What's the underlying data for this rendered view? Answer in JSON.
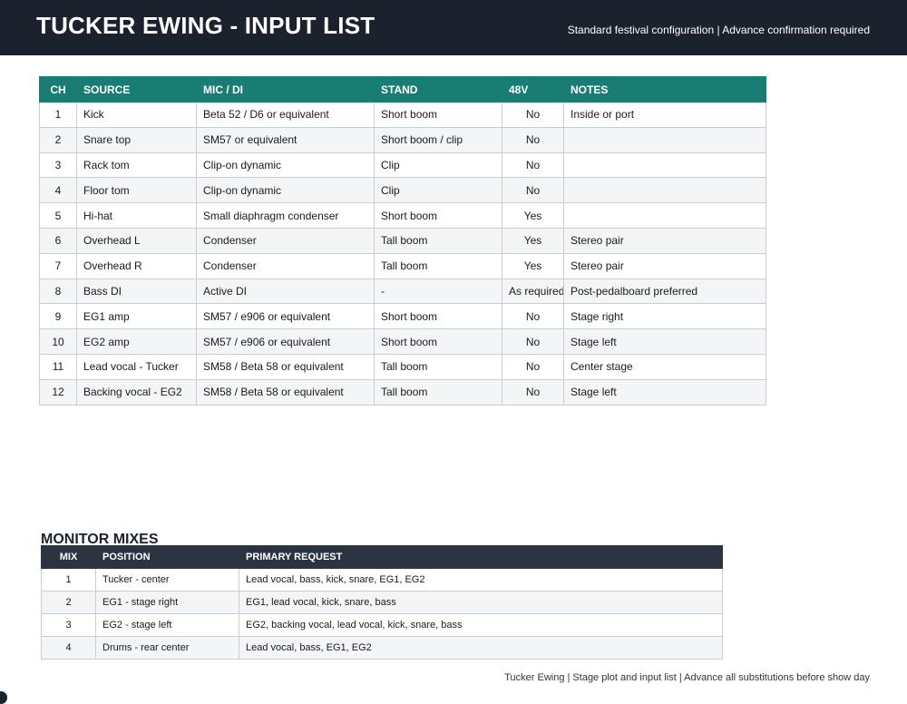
{
  "header": {
    "title": "TUCKER EWING - INPUT LIST",
    "subtitle": "Standard festival configuration | Advance confirmation required"
  },
  "input_list": {
    "columns": [
      "CH",
      "SOURCE",
      "MIC / DI",
      "STAND",
      "48V",
      "NOTES"
    ],
    "rows": [
      {
        "ch": "1",
        "source": "Kick",
        "mic": "Beta 52 / D6 or equivalent",
        "stand": "Short boom",
        "phantom": "No",
        "notes": "Inside or port"
      },
      {
        "ch": "2",
        "source": "Snare top",
        "mic": "SM57 or equivalent",
        "stand": "Short boom / clip",
        "phantom": "No",
        "notes": ""
      },
      {
        "ch": "3",
        "source": "Rack tom",
        "mic": "Clip-on dynamic",
        "stand": "Clip",
        "phantom": "No",
        "notes": ""
      },
      {
        "ch": "4",
        "source": "Floor tom",
        "mic": "Clip-on dynamic",
        "stand": "Clip",
        "phantom": "No",
        "notes": ""
      },
      {
        "ch": "5",
        "source": "Hi-hat",
        "mic": "Small diaphragm condenser",
        "stand": "Short boom",
        "phantom": "Yes",
        "notes": ""
      },
      {
        "ch": "6",
        "source": "Overhead L",
        "mic": "Condenser",
        "stand": "Tall boom",
        "phantom": "Yes",
        "notes": "Stereo pair"
      },
      {
        "ch": "7",
        "source": "Overhead R",
        "mic": "Condenser",
        "stand": "Tall boom",
        "phantom": "Yes",
        "notes": "Stereo pair"
      },
      {
        "ch": "8",
        "source": "Bass DI",
        "mic": "Active DI",
        "stand": "-",
        "phantom": "As required",
        "notes": "Post-pedalboard preferred"
      },
      {
        "ch": "9",
        "source": "EG1 amp",
        "mic": "SM57 / e906 or equivalent",
        "stand": "Short boom",
        "phantom": "No",
        "notes": "Stage right"
      },
      {
        "ch": "10",
        "source": "EG2 amp",
        "mic": "SM57 / e906 or equivalent",
        "stand": "Short boom",
        "phantom": "No",
        "notes": "Stage left"
      },
      {
        "ch": "11",
        "source": "Lead vocal - Tucker",
        "mic": "SM58 / Beta 58 or equivalent",
        "stand": "Tall boom",
        "phantom": "No",
        "notes": "Center stage"
      },
      {
        "ch": "12",
        "source": "Backing vocal - EG2",
        "mic": "SM58 / Beta 58 or equivalent",
        "stand": "Tall boom",
        "phantom": "No",
        "notes": "Stage left"
      }
    ]
  },
  "monitor_mixes": {
    "title": "MONITOR MIXES",
    "columns": [
      "MIX",
      "POSITION",
      "PRIMARY REQUEST"
    ],
    "rows": [
      {
        "mix": "1",
        "position": "Tucker - center",
        "request": "Lead vocal, bass, kick, snare, EG1, EG2"
      },
      {
        "mix": "2",
        "position": "EG1 - stage right",
        "request": "EG1, lead vocal, kick, snare, bass"
      },
      {
        "mix": "3",
        "position": "EG2 - stage left",
        "request": "EG2, backing vocal, lead vocal, kick, snare, bass"
      },
      {
        "mix": "4",
        "position": "Drums - rear center",
        "request": "Lead vocal, bass, EG1, EG2"
      }
    ]
  },
  "footer": {
    "text": "Tucker Ewing | Stage plot and input list | Advance all substitutions before show day"
  },
  "colors": {
    "header_bg": "#1b212d",
    "input_header_bg": "#197d74",
    "monitor_header_bg": "#2c3442"
  }
}
